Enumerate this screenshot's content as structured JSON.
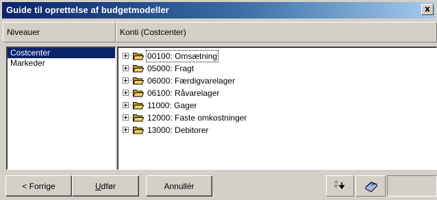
{
  "window": {
    "title": "Guide til oprettelse af budgetmodeller",
    "close_symbol": "x"
  },
  "headers": {
    "levels": "Niveauer",
    "accounts": "Konti (Costcenter)"
  },
  "levels": [
    {
      "label": "Costcenter",
      "selected": true
    },
    {
      "label": "Markeder",
      "selected": false
    }
  ],
  "tree": [
    {
      "label": "00100: Omsætning",
      "icon": "folder-open-icon",
      "focused": true
    },
    {
      "label": "05000: Fragt",
      "icon": "folder-open-icon",
      "focused": false
    },
    {
      "label": "06000: Færdigvarelager",
      "icon": "folder-open-icon",
      "focused": false
    },
    {
      "label": "06100: Råvarelager",
      "icon": "folder-open-icon",
      "focused": false
    },
    {
      "label": "11000: Gager",
      "icon": "folder-open-icon",
      "focused": false
    },
    {
      "label": "12000: Faste omkostninger",
      "icon": "folder-open-icon",
      "focused": false
    },
    {
      "label": "13000: Debitorer",
      "icon": "folder-open-icon",
      "focused": false
    }
  ],
  "buttons": {
    "previous": "< Forrige",
    "execute": "Udfør",
    "cancel": "Annullér"
  },
  "toolbar": {
    "sort_icon": "sort-arrows-icon",
    "print_icon": "print-icon"
  },
  "colors": {
    "title_start": "#0a246a",
    "title_end": "#a6caf0",
    "selection": "#0a246a",
    "folder": "#f0d060"
  }
}
